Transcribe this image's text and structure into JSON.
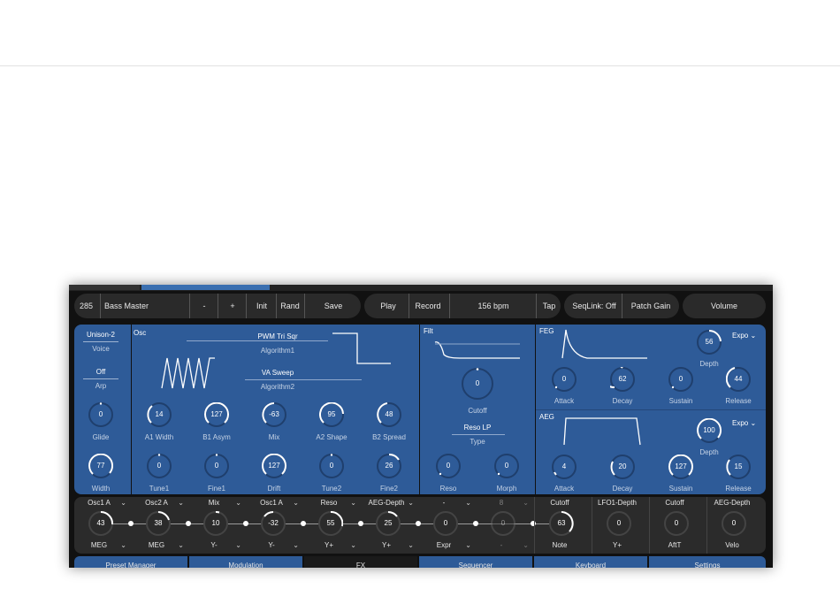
{
  "toolbar": {
    "preset_number": "285",
    "preset_name": "Bass Master",
    "minus": "-",
    "plus": "+",
    "init": "Init",
    "rand": "Rand",
    "save": "Save",
    "play": "Play",
    "record": "Record",
    "tempo": "156 bpm",
    "tap": "Tap",
    "seqlink": "SeqLink: Off",
    "patch_gain": "Patch Gain",
    "volume": "Volume"
  },
  "voice": {
    "voice_value": "Unison-2",
    "voice_label": "Voice",
    "arp_value": "Off",
    "arp_label": "Arp",
    "glide": "0",
    "glide_label": "Glide",
    "width": "77",
    "width_label": "Width"
  },
  "osc": {
    "title": "Osc",
    "algorithm1_value": "PWM Tri Sqr",
    "algorithm1_label": "Algorithm1",
    "algorithm2_value": "VA Sweep",
    "algorithm2_label": "Algorithm2",
    "row1": [
      {
        "value": "14",
        "label": "A1 Width"
      },
      {
        "value": "127",
        "label": "B1 Asym"
      },
      {
        "value": "-63",
        "label": "Mix"
      },
      {
        "value": "95",
        "label": "A2 Shape"
      },
      {
        "value": "48",
        "label": "B2 Spread"
      }
    ],
    "row2": [
      {
        "value": "0",
        "label": "Tune1"
      },
      {
        "value": "0",
        "label": "Fine1"
      },
      {
        "value": "127",
        "label": "Drift"
      },
      {
        "value": "0",
        "label": "Tune2"
      },
      {
        "value": "26",
        "label": "Fine2"
      }
    ]
  },
  "filt": {
    "title": "Filt",
    "cutoff": "0",
    "cutoff_label": "Cutoff",
    "type_value": "Reso LP",
    "type_label": "Type",
    "reso": "0",
    "reso_label": "Reso",
    "morph": "0",
    "morph_label": "Morph"
  },
  "feg": {
    "title": "FEG",
    "depth": "56",
    "depth_label": "Depth",
    "mode": "Expo",
    "attack": "0",
    "decay": "62",
    "sustain": "0",
    "release": "44",
    "attack_label": "Attack",
    "decay_label": "Decay",
    "sustain_label": "Sustain",
    "release_label": "Release"
  },
  "aeg": {
    "title": "AEG",
    "depth": "100",
    "depth_label": "Depth",
    "mode": "Expo",
    "attack": "4",
    "decay": "20",
    "sustain": "127",
    "release": "15",
    "attack_label": "Attack",
    "decay_label": "Decay",
    "sustain_label": "Sustain",
    "release_label": "Release"
  },
  "mod": [
    {
      "top": "Osc1 A",
      "value": "43",
      "bottom": "MEG"
    },
    {
      "top": "Osc2 A",
      "value": "38",
      "bottom": "MEG"
    },
    {
      "top": "Mix",
      "value": "10",
      "bottom": "Y-"
    },
    {
      "top": "Osc1 A",
      "value": "-32",
      "bottom": "Y-"
    },
    {
      "top": "Reso",
      "value": "55",
      "bottom": "Y+"
    },
    {
      "top": "AEG-Depth",
      "value": "25",
      "bottom": "Y+"
    },
    {
      "top": "-",
      "value": "0",
      "bottom": "Expr"
    },
    {
      "top": "8",
      "value": "0",
      "bottom": "-"
    },
    {
      "top": "Cutoff",
      "value": "63",
      "bottom": "Note"
    },
    {
      "top": "LFO1-Depth",
      "value": "0",
      "bottom": "Y+"
    },
    {
      "top": "Cutoff",
      "value": "0",
      "bottom": "AftT"
    },
    {
      "top": "AEG-Depth",
      "value": "0",
      "bottom": "Velo"
    }
  ],
  "tabs": [
    "Preset Manager",
    "Modulation",
    "FX",
    "Sequencer",
    "Keyboard",
    "Settings"
  ],
  "colors": {
    "panel": "#2e5b98",
    "dark": "#2b2b2b",
    "accent": "#ffffff"
  }
}
